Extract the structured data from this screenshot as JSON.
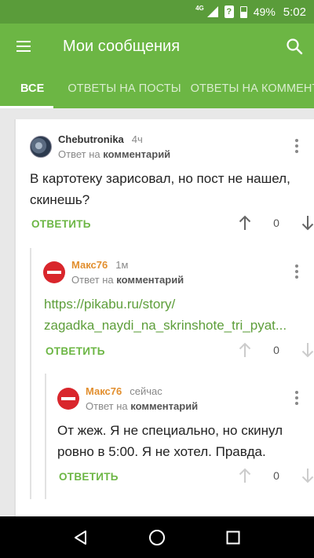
{
  "status_bar": {
    "network": "4G",
    "battery": "49%",
    "time": "5:02"
  },
  "app_bar": {
    "title": "Мои сообщения"
  },
  "tabs": [
    {
      "label": "ВСЕ",
      "active": true
    },
    {
      "label": "ОТВЕТЫ НА ПОСТЫ",
      "active": false
    },
    {
      "label": "ОТВЕТЫ НА КОММЕНТАРИИ",
      "active": false
    }
  ],
  "comments": [
    {
      "author": "Chebutronika",
      "time": "4ч",
      "reply_prefix": "Ответ на",
      "reply_target": "комментарий",
      "text": "В картотеку зарисовал, но пост не нашел, скинешь?",
      "reply_label": "ОТВЕТИТЬ",
      "score": "0"
    },
    {
      "author": "Макс76",
      "time": "1м",
      "reply_prefix": "Ответ на",
      "reply_target": "комментарий",
      "link_line1": "https://pikabu.ru/story/",
      "link_line2": "zagadka_naydi_na_skrinshote_tri_pyat...",
      "reply_label": "ОТВЕТИТЬ",
      "score": "0"
    },
    {
      "author": "Макс76",
      "time": "сейчас",
      "reply_prefix": "Ответ на",
      "reply_target": "комментарий",
      "text": "От жеж. Я не специально, но скинул ровно в 5:00. Я не хотел. Правда.",
      "reply_label": "ОТВЕТИТЬ",
      "score": "0"
    }
  ],
  "colors": {
    "primary": "#6cb644",
    "status_bar": "#5a9c3a",
    "author_orange": "#e28f2f",
    "avatar_red": "#d9262c"
  }
}
